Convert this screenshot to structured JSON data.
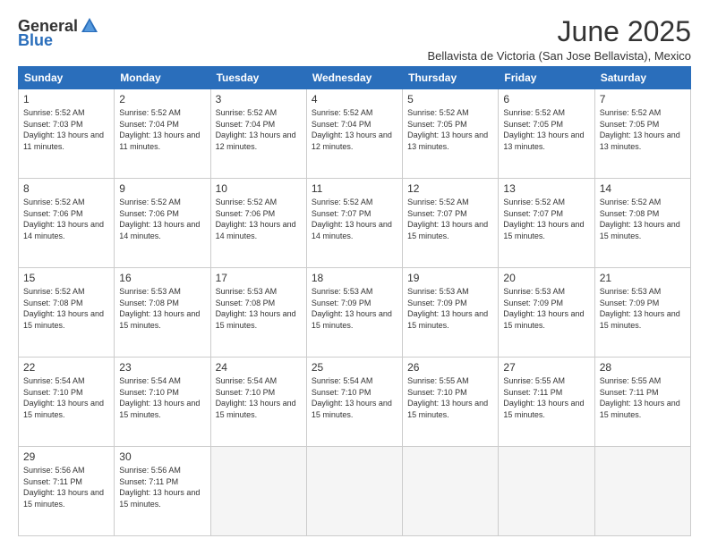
{
  "logo": {
    "general": "General",
    "blue": "Blue"
  },
  "title": "June 2025",
  "subtitle": "Bellavista de Victoria (San Jose Bellavista), Mexico",
  "days_header": [
    "Sunday",
    "Monday",
    "Tuesday",
    "Wednesday",
    "Thursday",
    "Friday",
    "Saturday"
  ],
  "weeks": [
    [
      {
        "day": "1",
        "info": "Sunrise: 5:52 AM\nSunset: 7:03 PM\nDaylight: 13 hours and 11 minutes."
      },
      {
        "day": "2",
        "info": "Sunrise: 5:52 AM\nSunset: 7:04 PM\nDaylight: 13 hours and 11 minutes."
      },
      {
        "day": "3",
        "info": "Sunrise: 5:52 AM\nSunset: 7:04 PM\nDaylight: 13 hours and 12 minutes."
      },
      {
        "day": "4",
        "info": "Sunrise: 5:52 AM\nSunset: 7:04 PM\nDaylight: 13 hours and 12 minutes."
      },
      {
        "day": "5",
        "info": "Sunrise: 5:52 AM\nSunset: 7:05 PM\nDaylight: 13 hours and 13 minutes."
      },
      {
        "day": "6",
        "info": "Sunrise: 5:52 AM\nSunset: 7:05 PM\nDaylight: 13 hours and 13 minutes."
      },
      {
        "day": "7",
        "info": "Sunrise: 5:52 AM\nSunset: 7:05 PM\nDaylight: 13 hours and 13 minutes."
      }
    ],
    [
      {
        "day": "8",
        "info": "Sunrise: 5:52 AM\nSunset: 7:06 PM\nDaylight: 13 hours and 14 minutes."
      },
      {
        "day": "9",
        "info": "Sunrise: 5:52 AM\nSunset: 7:06 PM\nDaylight: 13 hours and 14 minutes."
      },
      {
        "day": "10",
        "info": "Sunrise: 5:52 AM\nSunset: 7:06 PM\nDaylight: 13 hours and 14 minutes."
      },
      {
        "day": "11",
        "info": "Sunrise: 5:52 AM\nSunset: 7:07 PM\nDaylight: 13 hours and 14 minutes."
      },
      {
        "day": "12",
        "info": "Sunrise: 5:52 AM\nSunset: 7:07 PM\nDaylight: 13 hours and 15 minutes."
      },
      {
        "day": "13",
        "info": "Sunrise: 5:52 AM\nSunset: 7:07 PM\nDaylight: 13 hours and 15 minutes."
      },
      {
        "day": "14",
        "info": "Sunrise: 5:52 AM\nSunset: 7:08 PM\nDaylight: 13 hours and 15 minutes."
      }
    ],
    [
      {
        "day": "15",
        "info": "Sunrise: 5:52 AM\nSunset: 7:08 PM\nDaylight: 13 hours and 15 minutes."
      },
      {
        "day": "16",
        "info": "Sunrise: 5:53 AM\nSunset: 7:08 PM\nDaylight: 13 hours and 15 minutes."
      },
      {
        "day": "17",
        "info": "Sunrise: 5:53 AM\nSunset: 7:08 PM\nDaylight: 13 hours and 15 minutes."
      },
      {
        "day": "18",
        "info": "Sunrise: 5:53 AM\nSunset: 7:09 PM\nDaylight: 13 hours and 15 minutes."
      },
      {
        "day": "19",
        "info": "Sunrise: 5:53 AM\nSunset: 7:09 PM\nDaylight: 13 hours and 15 minutes."
      },
      {
        "day": "20",
        "info": "Sunrise: 5:53 AM\nSunset: 7:09 PM\nDaylight: 13 hours and 15 minutes."
      },
      {
        "day": "21",
        "info": "Sunrise: 5:53 AM\nSunset: 7:09 PM\nDaylight: 13 hours and 15 minutes."
      }
    ],
    [
      {
        "day": "22",
        "info": "Sunrise: 5:54 AM\nSunset: 7:10 PM\nDaylight: 13 hours and 15 minutes."
      },
      {
        "day": "23",
        "info": "Sunrise: 5:54 AM\nSunset: 7:10 PM\nDaylight: 13 hours and 15 minutes."
      },
      {
        "day": "24",
        "info": "Sunrise: 5:54 AM\nSunset: 7:10 PM\nDaylight: 13 hours and 15 minutes."
      },
      {
        "day": "25",
        "info": "Sunrise: 5:54 AM\nSunset: 7:10 PM\nDaylight: 13 hours and 15 minutes."
      },
      {
        "day": "26",
        "info": "Sunrise: 5:55 AM\nSunset: 7:10 PM\nDaylight: 13 hours and 15 minutes."
      },
      {
        "day": "27",
        "info": "Sunrise: 5:55 AM\nSunset: 7:11 PM\nDaylight: 13 hours and 15 minutes."
      },
      {
        "day": "28",
        "info": "Sunrise: 5:55 AM\nSunset: 7:11 PM\nDaylight: 13 hours and 15 minutes."
      }
    ],
    [
      {
        "day": "29",
        "info": "Sunrise: 5:56 AM\nSunset: 7:11 PM\nDaylight: 13 hours and 15 minutes."
      },
      {
        "day": "30",
        "info": "Sunrise: 5:56 AM\nSunset: 7:11 PM\nDaylight: 13 hours and 15 minutes."
      },
      {
        "day": "",
        "info": ""
      },
      {
        "day": "",
        "info": ""
      },
      {
        "day": "",
        "info": ""
      },
      {
        "day": "",
        "info": ""
      },
      {
        "day": "",
        "info": ""
      }
    ]
  ]
}
